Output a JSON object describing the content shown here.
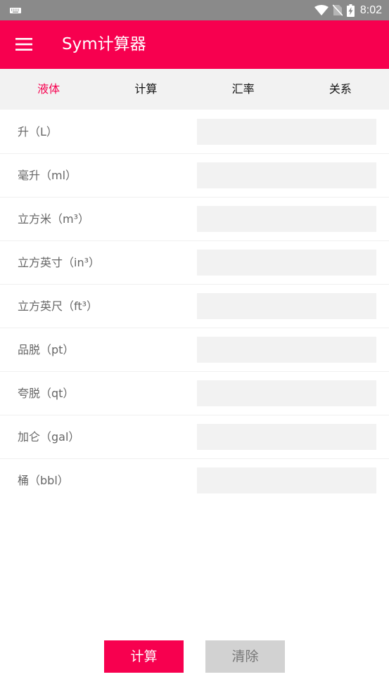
{
  "status_bar": {
    "time": "8:02",
    "icons": [
      "keyboard-icon",
      "wifi-icon",
      "no-sim-icon",
      "battery-charging-icon"
    ]
  },
  "app_bar": {
    "title": "Sym计算器",
    "menu_icon": "hamburger-menu-icon"
  },
  "tabs": [
    {
      "label": "液体",
      "active": true
    },
    {
      "label": "计算",
      "active": false
    },
    {
      "label": "汇率",
      "active": false
    },
    {
      "label": "关系",
      "active": false
    }
  ],
  "units": [
    {
      "label": "升（L）",
      "value": ""
    },
    {
      "label": "毫升（ml）",
      "value": ""
    },
    {
      "label": "立方米（m³）",
      "value": ""
    },
    {
      "label": "立方英寸（in³）",
      "value": ""
    },
    {
      "label": "立方英尺（ft³）",
      "value": ""
    },
    {
      "label": "品脱（pt）",
      "value": ""
    },
    {
      "label": "夸脱（qt）",
      "value": ""
    },
    {
      "label": "加仑（gal）",
      "value": ""
    },
    {
      "label": "桶（bbl）",
      "value": ""
    }
  ],
  "actions": {
    "calculate_label": "计算",
    "clear_label": "清除"
  },
  "colors": {
    "accent": "#f7004f",
    "status_bar": "#8a8a8a",
    "tab_bar": "#f2f2f2",
    "input_bg": "#f2f2f2",
    "clear_button": "#d2d2d2"
  }
}
